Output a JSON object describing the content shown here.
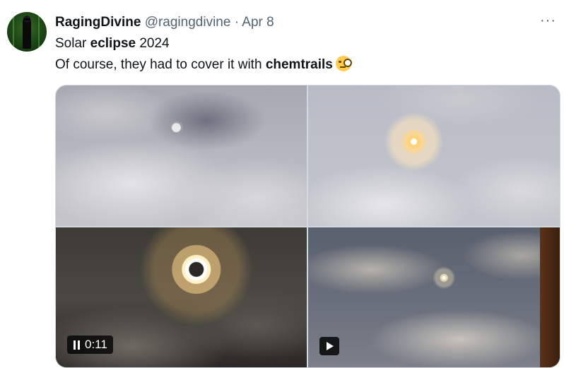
{
  "tweet": {
    "author_name": "RagingDivine",
    "handle": "@ragingdivine",
    "separator": "·",
    "date": "Apr 8",
    "more_label": "···",
    "line1_pre": "Solar ",
    "line1_bold": "eclipse",
    "line1_post": " 2024",
    "line2_pre": "Of course, they had to cover it with ",
    "line2_bold": "chemtrails",
    "emoji_name": "face-with-monocle-icon"
  },
  "media": {
    "items": [
      {
        "type": "photo"
      },
      {
        "type": "photo"
      },
      {
        "type": "video",
        "duration": "0:11",
        "state": "playing"
      },
      {
        "type": "video",
        "state": "paused"
      }
    ]
  },
  "colors": {
    "text": "#0f1419",
    "secondary": "#536471",
    "border": "#cfd9de"
  }
}
